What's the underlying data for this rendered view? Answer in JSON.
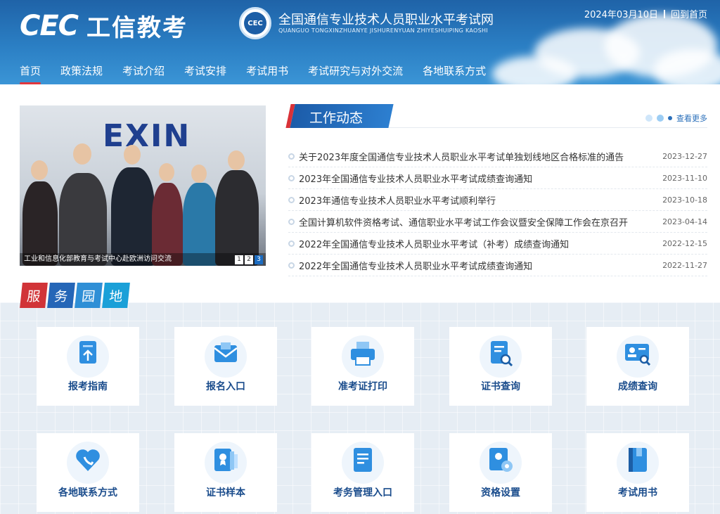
{
  "header": {
    "logo_mark": "CEC",
    "logo_text": "工信教考",
    "emblem_text": "CEC",
    "site_name": "全国通信专业技术人员职业水平考试网",
    "site_pinyin": "QUANGUO TONGXINZHUANYE JISHURENYUAN ZHIYESHUIPING KAOSHI",
    "date": "2024年03月10日",
    "home_link": "回到首页"
  },
  "nav": [
    "首页",
    "政策法规",
    "考试介绍",
    "考试安排",
    "考试用书",
    "考试研究与对外交流",
    "各地联系方式"
  ],
  "carousel": {
    "logo_text": "EXIN",
    "caption": "工业和信息化部教育与考试中心赴欧洲访问交流",
    "pages": [
      "1",
      "2",
      "3"
    ],
    "active_page": 3
  },
  "news": {
    "title": "工作动态",
    "more": "查看更多",
    "items": [
      {
        "title": "关于2023年度全国通信专业技术人员职业水平考试单独划线地区合格标准的通告",
        "date": "2023-12-27"
      },
      {
        "title": "2023年全国通信专业技术人员职业水平考试成绩查询通知",
        "date": "2023-11-10"
      },
      {
        "title": "2023年通信专业技术人员职业水平考试顺利举行",
        "date": "2023-10-18"
      },
      {
        "title": "全国计算机软件资格考试、通信职业水平考试工作会议暨安全保障工作会在京召开",
        "date": "2023-04-14"
      },
      {
        "title": "2022年全国通信专业技术人员职业水平考试（补考）成绩查询通知",
        "date": "2022-12-15"
      },
      {
        "title": "2022年全国通信专业技术人员职业水平考试成绩查询通知",
        "date": "2022-11-27"
      }
    ]
  },
  "services": {
    "title_chars": [
      "服",
      "务",
      "园",
      "地"
    ],
    "cards": [
      {
        "label": "报考指南",
        "icon": "upload-doc-icon"
      },
      {
        "label": "报名入口",
        "icon": "envelope-icon"
      },
      {
        "label": "准考证打印",
        "icon": "printer-icon"
      },
      {
        "label": "证书查询",
        "icon": "doc-search-icon"
      },
      {
        "label": "成绩查询",
        "icon": "id-card-search-icon"
      },
      {
        "label": "各地联系方式",
        "icon": "heart-phone-icon"
      },
      {
        "label": "证书样本",
        "icon": "certificate-icon"
      },
      {
        "label": "考务管理入口",
        "icon": "clipboard-icon"
      },
      {
        "label": "资格设置",
        "icon": "settings-doc-icon"
      },
      {
        "label": "考试用书",
        "icon": "book-icon"
      }
    ]
  },
  "colors": {
    "primary": "#1f63a8",
    "accent_red": "#d93238",
    "label_blue": "#1a4c8c"
  }
}
